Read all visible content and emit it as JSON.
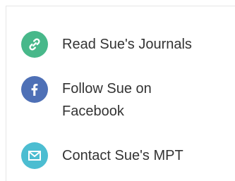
{
  "links": [
    {
      "label": "Read Sue's Journals",
      "icon": "link-icon",
      "color": "#48b88a"
    },
    {
      "label": "Follow Sue on\nFacebook",
      "icon": "facebook-icon",
      "color": "#4e70b6"
    },
    {
      "label": "Contact Sue's MPT",
      "icon": "envelope-icon",
      "color": "#4cbdd1"
    }
  ]
}
